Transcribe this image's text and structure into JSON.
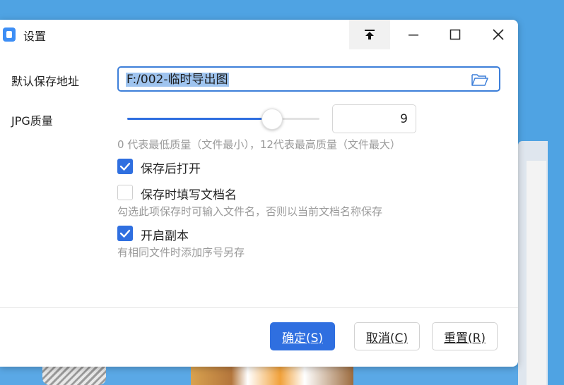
{
  "window": {
    "title": "设置",
    "icons": [
      "app-icon",
      "pin-top-icon",
      "minimize-icon",
      "maximize-icon",
      "close-icon"
    ]
  },
  "save_path": {
    "label": "默认保存地址",
    "value": "F:/002-临时导出图",
    "icon": "folder-icon"
  },
  "jpg_quality": {
    "label": "JPG质量",
    "value": "9",
    "level_fraction": 0.75,
    "hint": "0 代表最低质量（文件最小），12代表最高质量（文件最大）"
  },
  "options": [
    {
      "label": "保存后打开",
      "checked": true
    },
    {
      "label": "保存时填写文档名",
      "checked": false,
      "hint": "勾选此项保存时可输入文件名，否则以当前文档名称保存"
    },
    {
      "label": "开启副本",
      "checked": true,
      "hint": "有相同文件时添加序号另存"
    }
  ],
  "buttons": {
    "ok": "确定(S)",
    "cancel": "取消(C)",
    "reset": "重置(R)"
  },
  "colors": {
    "accent": "#2f6fe0",
    "background": "#4fa3e3"
  }
}
